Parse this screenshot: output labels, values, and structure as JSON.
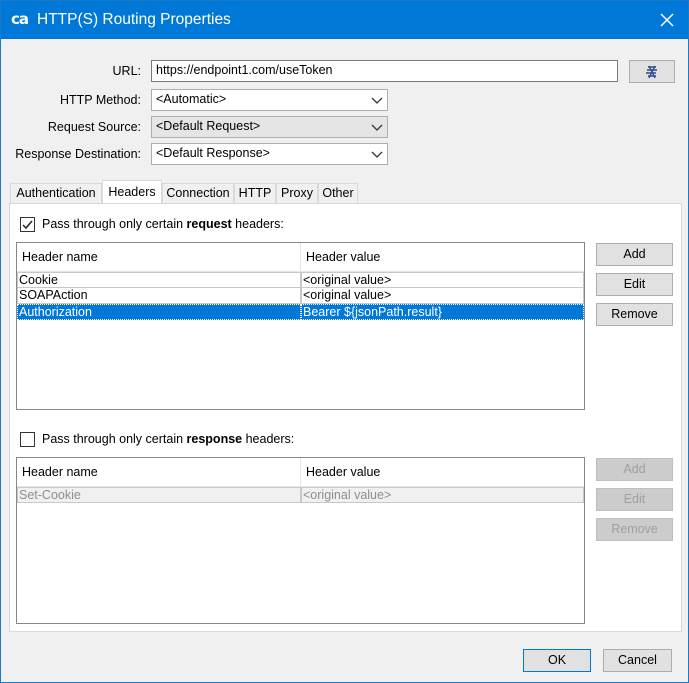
{
  "window": {
    "logo": "ca",
    "title": "HTTP(S) Routing Properties"
  },
  "form": {
    "url_label": "URL:",
    "url_value": "https://endpoint1.com/useToken",
    "method_label": "HTTP Method:",
    "method_value": "<Automatic>",
    "request_source_label": "Request Source:",
    "request_source_value": "<Default Request>",
    "response_dest_label": "Response Destination:",
    "response_dest_value": "<Default Response>"
  },
  "tabs": [
    {
      "label": "Authentication"
    },
    {
      "label": "Headers"
    },
    {
      "label": "Connection"
    },
    {
      "label": "HTTP"
    },
    {
      "label": "Proxy"
    },
    {
      "label": "Other"
    }
  ],
  "request_section": {
    "checked": true,
    "prefix": "Pass through only certain ",
    "bold": "request",
    "suffix": " headers:",
    "columns": [
      "Header name",
      "Header value"
    ],
    "rows": [
      {
        "name": "Cookie",
        "value": "<original value>"
      },
      {
        "name": "SOAPAction",
        "value": "<original value>"
      },
      {
        "name": "Authorization",
        "value": "Bearer ${jsonPath.result}"
      }
    ],
    "buttons": {
      "add": "Add",
      "edit": "Edit",
      "remove": "Remove"
    }
  },
  "response_section": {
    "checked": false,
    "prefix": "Pass through only certain ",
    "bold": "response",
    "suffix": " headers:",
    "columns": [
      "Header name",
      "Header value"
    ],
    "rows": [
      {
        "name": "Set-Cookie",
        "value": "<original value>"
      }
    ],
    "buttons": {
      "add": "Add",
      "edit": "Edit",
      "remove": "Remove"
    }
  },
  "footer": {
    "ok": "OK",
    "cancel": "Cancel"
  },
  "colors": {
    "titlebar": "#0078d7",
    "selection": "#0078d7"
  }
}
